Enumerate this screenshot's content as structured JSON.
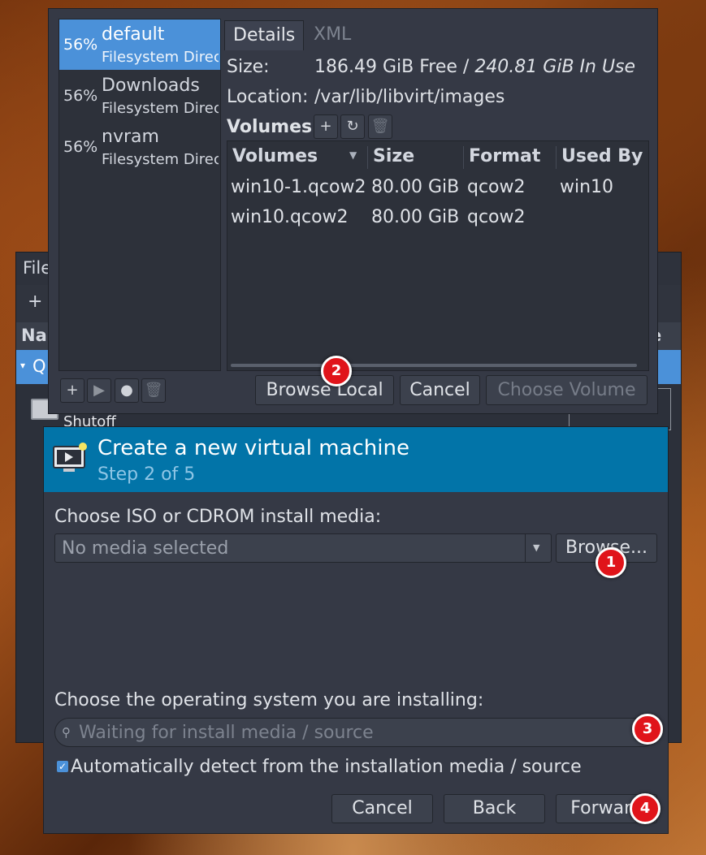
{
  "manager": {
    "menu_fragment": "File",
    "toolbar_plus": "+",
    "header_name": "Na",
    "header_right": "e",
    "row_fragment": "Q",
    "vm_state": "Shutoff"
  },
  "storage": {
    "pools": [
      {
        "percent": "56%",
        "name": "default",
        "type": "Filesystem Directory"
      },
      {
        "percent": "56%",
        "name": "Downloads",
        "type": "Filesystem Directory"
      },
      {
        "percent": "56%",
        "name": "nvram",
        "type": "Filesystem Directory"
      }
    ],
    "tabs": [
      "Details",
      "XML"
    ],
    "size_label": "Size:",
    "size_free": "186.49 GiB Free / ",
    "size_in_use": "240.81 GiB In Use",
    "location_label": "Location:",
    "location_value": "/var/lib/libvirt/images",
    "volumes_label": "Volumes",
    "table_headers": [
      "Volumes",
      "Size",
      "Format",
      "Used By"
    ],
    "volumes": [
      {
        "name": "win10-1.qcow2",
        "size": "80.00 GiB",
        "format": "qcow2",
        "used_by": "win10"
      },
      {
        "name": "win10.qcow2",
        "size": "80.00 GiB",
        "format": "qcow2",
        "used_by": ""
      }
    ],
    "buttons": {
      "browse_local": "Browse Local",
      "cancel": "Cancel",
      "choose_volume": "Choose Volume"
    }
  },
  "newvm": {
    "title": "Create a new virtual machine",
    "step": "Step 2 of 5",
    "iso_label": "Choose ISO or CDROM install media:",
    "iso_value": "No media selected",
    "browse": "Browse...",
    "os_label": "Choose the operating system you are installing:",
    "os_placeholder": "Waiting for install media / source",
    "auto_detect": "Automatically detect from the installation media / source",
    "auto_detect_checked": true,
    "buttons": {
      "cancel": "Cancel",
      "back": "Back",
      "forward": "Forward"
    }
  },
  "annotations": [
    "1",
    "2",
    "3",
    "4"
  ],
  "colors": {
    "accent_blue": "#4b91d9",
    "header_blue": "#0274a8",
    "badge_red": "#e0141a",
    "panel": "#353945"
  }
}
